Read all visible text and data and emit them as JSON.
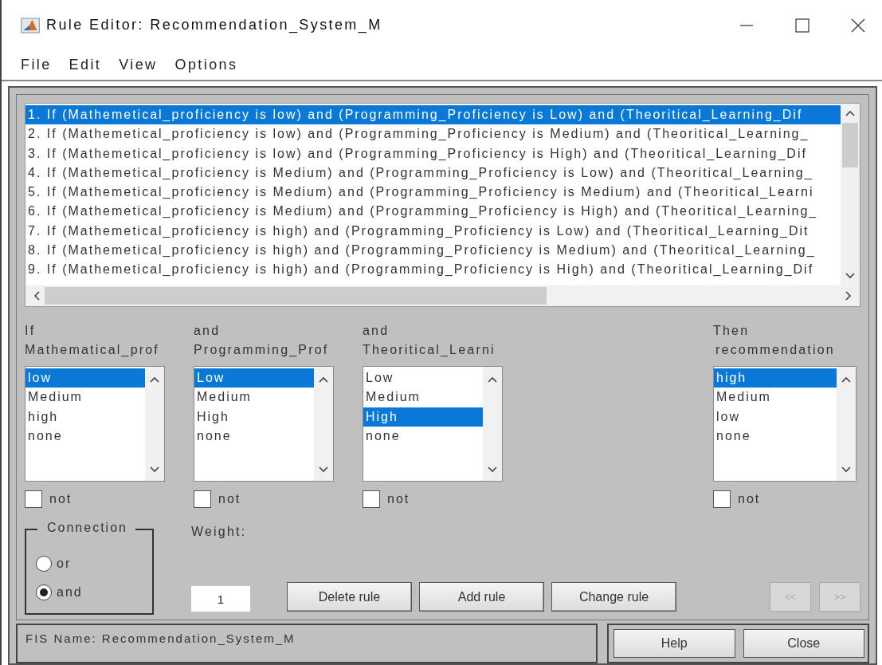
{
  "window": {
    "title": "Rule Editor: Recommendation_System_M"
  },
  "menu": [
    "File",
    "Edit",
    "View",
    "Options"
  ],
  "rules": [
    {
      "text": "1. If (Mathemetical_proficiency is low) and (Programming_Proficiency is Low) and (Theoritical_Learning_Dif",
      "selected": true
    },
    {
      "text": "2. If (Mathemetical_proficiency is low) and (Programming_Proficiency is Medium) and (Theoritical_Learning_",
      "selected": false
    },
    {
      "text": "3. If (Mathemetical_proficiency is low) and (Programming_Proficiency is High) and (Theoritical_Learning_Dif",
      "selected": false
    },
    {
      "text": "4. If (Mathemetical_proficiency is Medium) and (Programming_Proficiency is Low) and (Theoritical_Learning_",
      "selected": false
    },
    {
      "text": "5. If (Mathemetical_proficiency is Medium) and (Programming_Proficiency is Medium) and (Theoritical_Learni",
      "selected": false
    },
    {
      "text": "6. If (Mathemetical_proficiency is Medium) and (Programming_Proficiency is High) and (Theoritical_Learning_",
      "selected": false
    },
    {
      "text": "7. If (Mathemetical_proficiency is high) and (Programming_Proficiency is Low) and (Theoritical_Learning_Dit",
      "selected": false
    },
    {
      "text": "8. If (Mathemetical_proficiency is high) and (Programming_Proficiency is Medium) and (Theoritical_Learning_",
      "selected": false
    },
    {
      "text": "9. If (Mathemetical_proficiency is high) and (Programming_Proficiency is High) and (Theoritical_Learning_Dif",
      "selected": false
    }
  ],
  "variables": [
    {
      "kind": "input",
      "connector": "If",
      "name": "Mathematical_prof",
      "not": false,
      "options": [
        {
          "label": "low",
          "selected": true
        },
        {
          "label": "Medium",
          "selected": false
        },
        {
          "label": "high",
          "selected": false
        },
        {
          "label": "none",
          "selected": false
        }
      ],
      "not_label": "not"
    },
    {
      "kind": "input",
      "connector": "and",
      "name": "Programming_Prof",
      "not": false,
      "options": [
        {
          "label": "Low",
          "selected": true
        },
        {
          "label": "Medium",
          "selected": false
        },
        {
          "label": "High",
          "selected": false
        },
        {
          "label": "none",
          "selected": false
        }
      ],
      "not_label": "not"
    },
    {
      "kind": "input",
      "connector": "and",
      "name": "Theoritical_Learni",
      "not": false,
      "options": [
        {
          "label": "Low",
          "selected": false
        },
        {
          "label": "Medium",
          "selected": false
        },
        {
          "label": "High",
          "selected": true
        },
        {
          "label": "none",
          "selected": false
        }
      ],
      "not_label": "not"
    },
    {
      "kind": "output",
      "connector": "Then",
      "name": "recommendation",
      "not": false,
      "options": [
        {
          "label": "high",
          "selected": true
        },
        {
          "label": "Medium",
          "selected": false
        },
        {
          "label": "low",
          "selected": false
        },
        {
          "label": "none",
          "selected": false
        }
      ],
      "not_label": "not"
    }
  ],
  "connection": {
    "title": "Connection",
    "options": [
      {
        "label": "or",
        "selected": false
      },
      {
        "label": "and",
        "selected": true
      }
    ]
  },
  "weight": {
    "label": "Weight:",
    "value": "1"
  },
  "buttons": [
    {
      "label": "Delete rule",
      "disabled": false
    },
    {
      "label": "Add rule",
      "disabled": false
    },
    {
      "label": "Change rule",
      "disabled": false
    }
  ],
  "nav_buttons": [
    {
      "label": "<<",
      "disabled": true
    },
    {
      "label": ">>",
      "disabled": true
    }
  ],
  "status": "FIS Name: Recommendation_System_M",
  "footer_buttons": [
    "Help",
    "Close"
  ]
}
